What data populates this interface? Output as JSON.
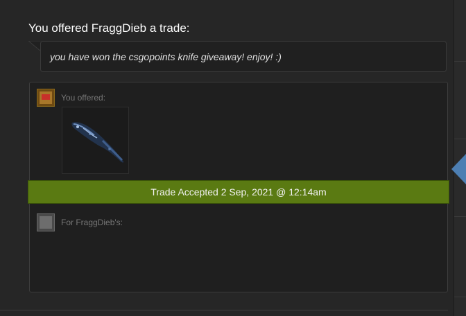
{
  "trade": {
    "headline": "You offered FraggDieb a trade:",
    "message": "you have won the csgopoints knife giveaway! enjoy! :)",
    "you_offered_label": "You offered:",
    "for_label": "For FraggDieb's:",
    "status": "Trade Accepted 2 Sep, 2021 @ 12:14am",
    "offered_items": [
      "knife-icon"
    ],
    "status_color": "#5a7a12"
  }
}
